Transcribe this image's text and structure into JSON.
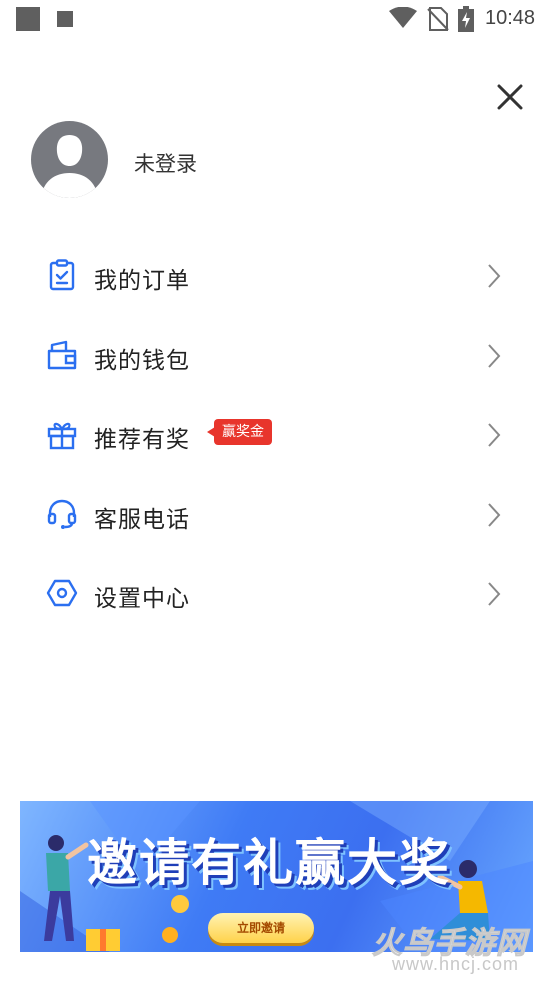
{
  "status_bar": {
    "time": "10:48",
    "icons": [
      "notification-square-icon",
      "notification-small-square-icon",
      "wifi-icon",
      "no-sim-icon",
      "battery-charging-icon"
    ]
  },
  "header": {
    "close_icon": "close-icon"
  },
  "profile": {
    "avatar_icon": "default-avatar-icon",
    "login_status": "未登录"
  },
  "menu": {
    "accent_color": "#2b6ff0",
    "items": [
      {
        "label": "我的订单",
        "icon": "order-clipboard-icon"
      },
      {
        "label": "我的钱包",
        "icon": "wallet-icon"
      },
      {
        "label": "推荐有奖",
        "icon": "gift-icon",
        "badge": "赢奖金"
      },
      {
        "label": "客服电话",
        "icon": "headset-icon"
      },
      {
        "label": "设置中心",
        "icon": "settings-hexagon-icon"
      }
    ]
  },
  "banner": {
    "title": "邀请有礼赢大奖",
    "button_label": "立即邀请"
  },
  "watermark": {
    "text": "火鸟手游网",
    "url": "www.hncj.com"
  }
}
